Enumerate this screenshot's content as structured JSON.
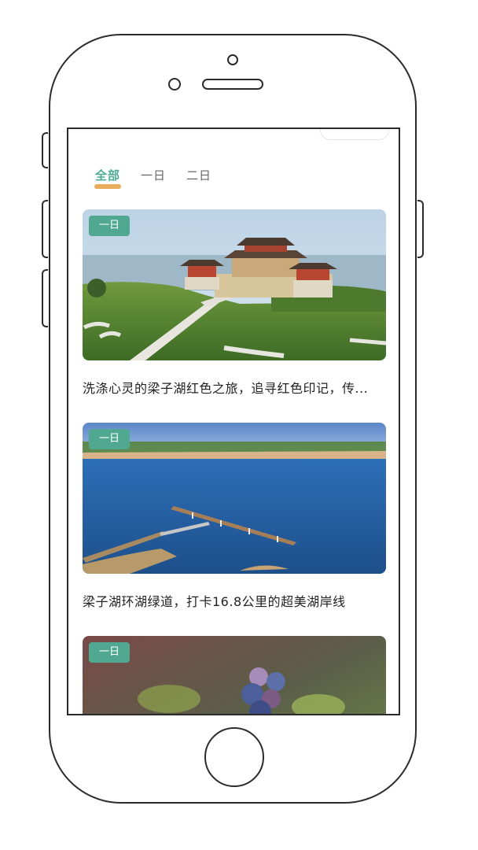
{
  "tabs": [
    {
      "label": "全部",
      "active": true
    },
    {
      "label": "一日",
      "active": false
    },
    {
      "label": "二日",
      "active": false
    }
  ],
  "cards": [
    {
      "badge": "一日",
      "title": "洗涤心灵的梁子湖红色之旅，追寻红色印记，传..."
    },
    {
      "badge": "一日",
      "title": "梁子湖环湖绿道，打卡16.8公里的超美湖岸线"
    },
    {
      "badge": "一日",
      "title": ""
    }
  ],
  "colors": {
    "accent": "#4bab93",
    "badge_bg": "#4fa88f",
    "tab_underline": "#e7a24a"
  }
}
